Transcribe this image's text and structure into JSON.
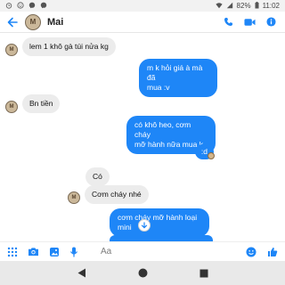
{
  "status_bar": {
    "battery": "82%",
    "time": "11:02"
  },
  "header": {
    "contact_name": "Mai",
    "avatar_initial": "M"
  },
  "messages": [
    {
      "dir": "in",
      "text": "lem 1 khô gà túi nửa kg"
    },
    {
      "dir": "out",
      "lines": [
        "m k hỏi giá à mà đã",
        "mua :v"
      ]
    },
    {
      "dir": "in",
      "text": "Bn tiền"
    },
    {
      "dir": "out",
      "lines": [
        "có khô heo, cơm cháy",
        "mỡ hành nữa mua k"
      ]
    },
    {
      "dir": "out",
      "text": ":d"
    },
    {
      "dir": "in",
      "text": "Có"
    },
    {
      "dir": "in",
      "text": "Cơm cháy nhé"
    },
    {
      "dir": "out",
      "lines": [
        "cơm cháy mỡ hành loại",
        "mini"
      ]
    }
  ],
  "composer": {
    "placeholder": "Aa"
  },
  "colors": {
    "accent": "#1e86f7",
    "incoming_bubble": "#ececec"
  }
}
